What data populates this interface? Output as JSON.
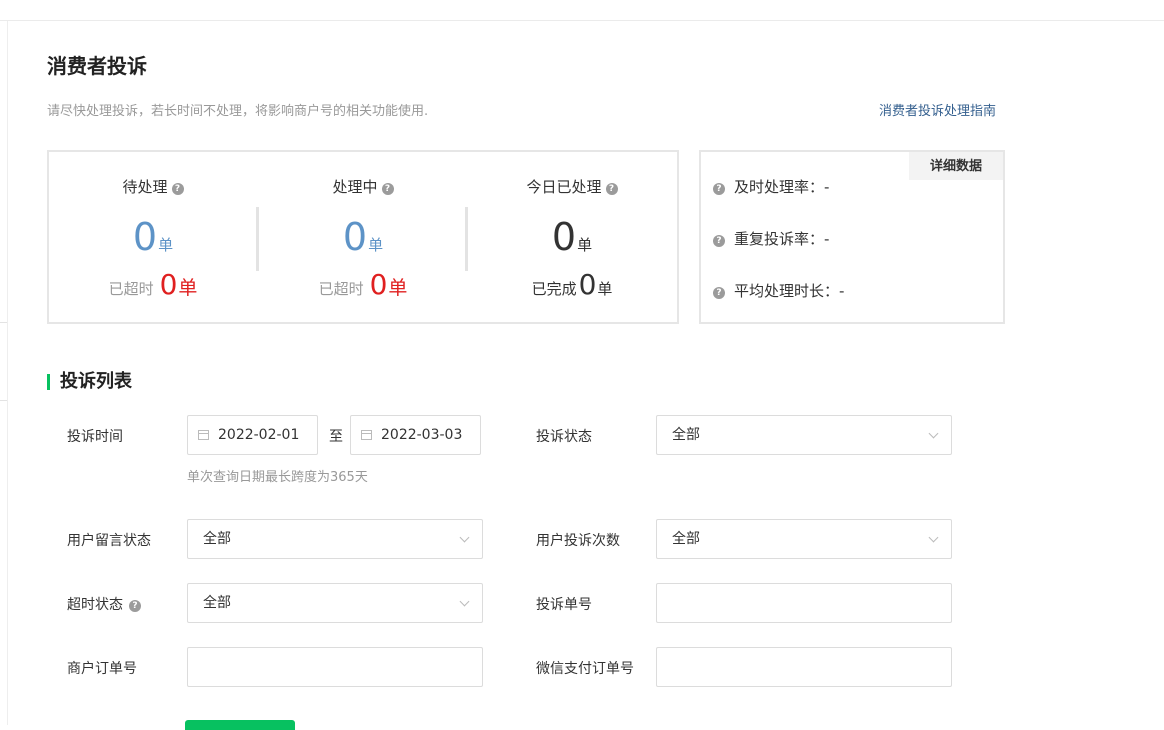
{
  "page": {
    "title": "消费者投诉",
    "subtitle": "请尽快处理投诉，若长时间不处理，将影响商户号的相关功能使用.",
    "guide_link": "消费者投诉处理指南"
  },
  "stats": {
    "pending": {
      "label": "待处理",
      "count": "0",
      "unit": "单",
      "overdue_label": "已超时",
      "overdue_count": "0",
      "overdue_unit": "单"
    },
    "processing": {
      "label": "处理中",
      "count": "0",
      "unit": "单",
      "overdue_label": "已超时",
      "overdue_count": "0",
      "overdue_unit": "单"
    },
    "today": {
      "label": "今日已处理",
      "count": "0",
      "unit": "单",
      "done_label": "已完成",
      "done_count": "0",
      "done_unit": "单"
    }
  },
  "details": {
    "button": "详细数据",
    "metrics": [
      {
        "label": "及时处理率：",
        "value": "-"
      },
      {
        "label": "重复投诉率：",
        "value": "-"
      },
      {
        "label": "平均处理时长：",
        "value": "-"
      }
    ]
  },
  "list": {
    "title": "投诉列表",
    "filters": {
      "complaint_time": {
        "label": "投诉时间",
        "start": "2022-02-01",
        "separator": "至",
        "end": "2022-03-03",
        "hint": "单次查询日期最长跨度为365天"
      },
      "complaint_status": {
        "label": "投诉状态",
        "value": "全部"
      },
      "message_status": {
        "label": "用户留言状态",
        "value": "全部"
      },
      "complaint_count": {
        "label": "用户投诉次数",
        "value": "全部"
      },
      "timeout_status": {
        "label": "超时状态",
        "value": "全部"
      },
      "complaint_no": {
        "label": "投诉单号",
        "value": ""
      },
      "merchant_order_no": {
        "label": "商户订单号",
        "value": ""
      },
      "wechat_order_no": {
        "label": "微信支付订单号",
        "value": ""
      }
    }
  },
  "colors": {
    "accent_green": "#07c160",
    "stat_blue": "#5d93c7",
    "alert_red": "#e02020",
    "link_blue": "#35608f"
  },
  "icons": {
    "help": "question-circle-icon",
    "calendar": "calendar-icon",
    "dropdown": "chevron-down-icon"
  }
}
